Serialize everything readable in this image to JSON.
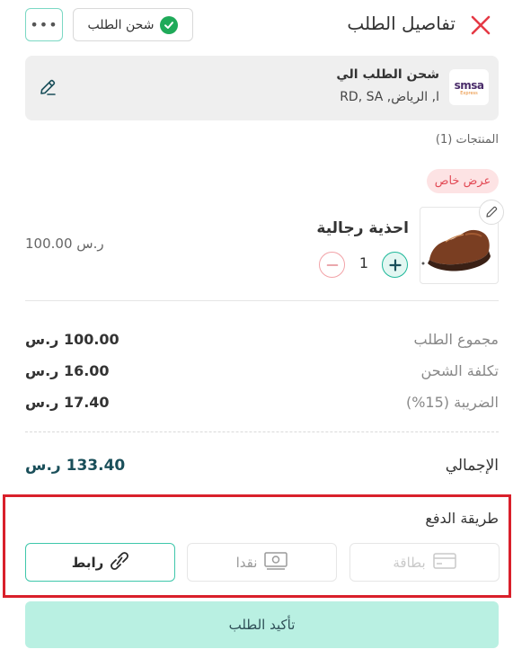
{
  "header": {
    "title": "تفاصيل الطلب",
    "status_label": "شحن الطلب",
    "more_label": "•••"
  },
  "shipping": {
    "title": "شحن الطلب الي",
    "address": "ا, الرياض, RD, SA",
    "logo": {
      "left": "smsa",
      "right": "Express"
    }
  },
  "products": {
    "section_label": "المنتجات (1)",
    "offer_badge": "عرض خاص",
    "items": [
      {
        "name": "احذية رجالية",
        "quantity": "1",
        "price": "100.00 ر.س"
      }
    ]
  },
  "summary": {
    "rows": [
      {
        "label": "مجموع الطلب",
        "value": "100.00 ر.س"
      },
      {
        "label": "تكلفة الشحن",
        "value": "16.00 ر.س"
      },
      {
        "label": "الضريبة  (15%)",
        "value": "17.40 ر.س"
      }
    ],
    "total_label": "الإجمالي",
    "total_value": "133.40 ر.س"
  },
  "payment": {
    "title": "طريقة الدفع",
    "options": [
      {
        "label": "بطاقة",
        "icon": "card-icon",
        "state": "disabled"
      },
      {
        "label": "نقدا",
        "icon": "cash-icon",
        "state": "inactive"
      },
      {
        "label": "رابط",
        "icon": "link-icon",
        "state": "selected"
      }
    ]
  },
  "confirm_label": "تأكيد الطلب",
  "colors": {
    "accent": "#3fc7ab",
    "primary_dark": "#1a4f5a",
    "danger": "#e24a55",
    "highlight_border": "#d9202b",
    "confirm_bg": "#b9f0e2"
  }
}
